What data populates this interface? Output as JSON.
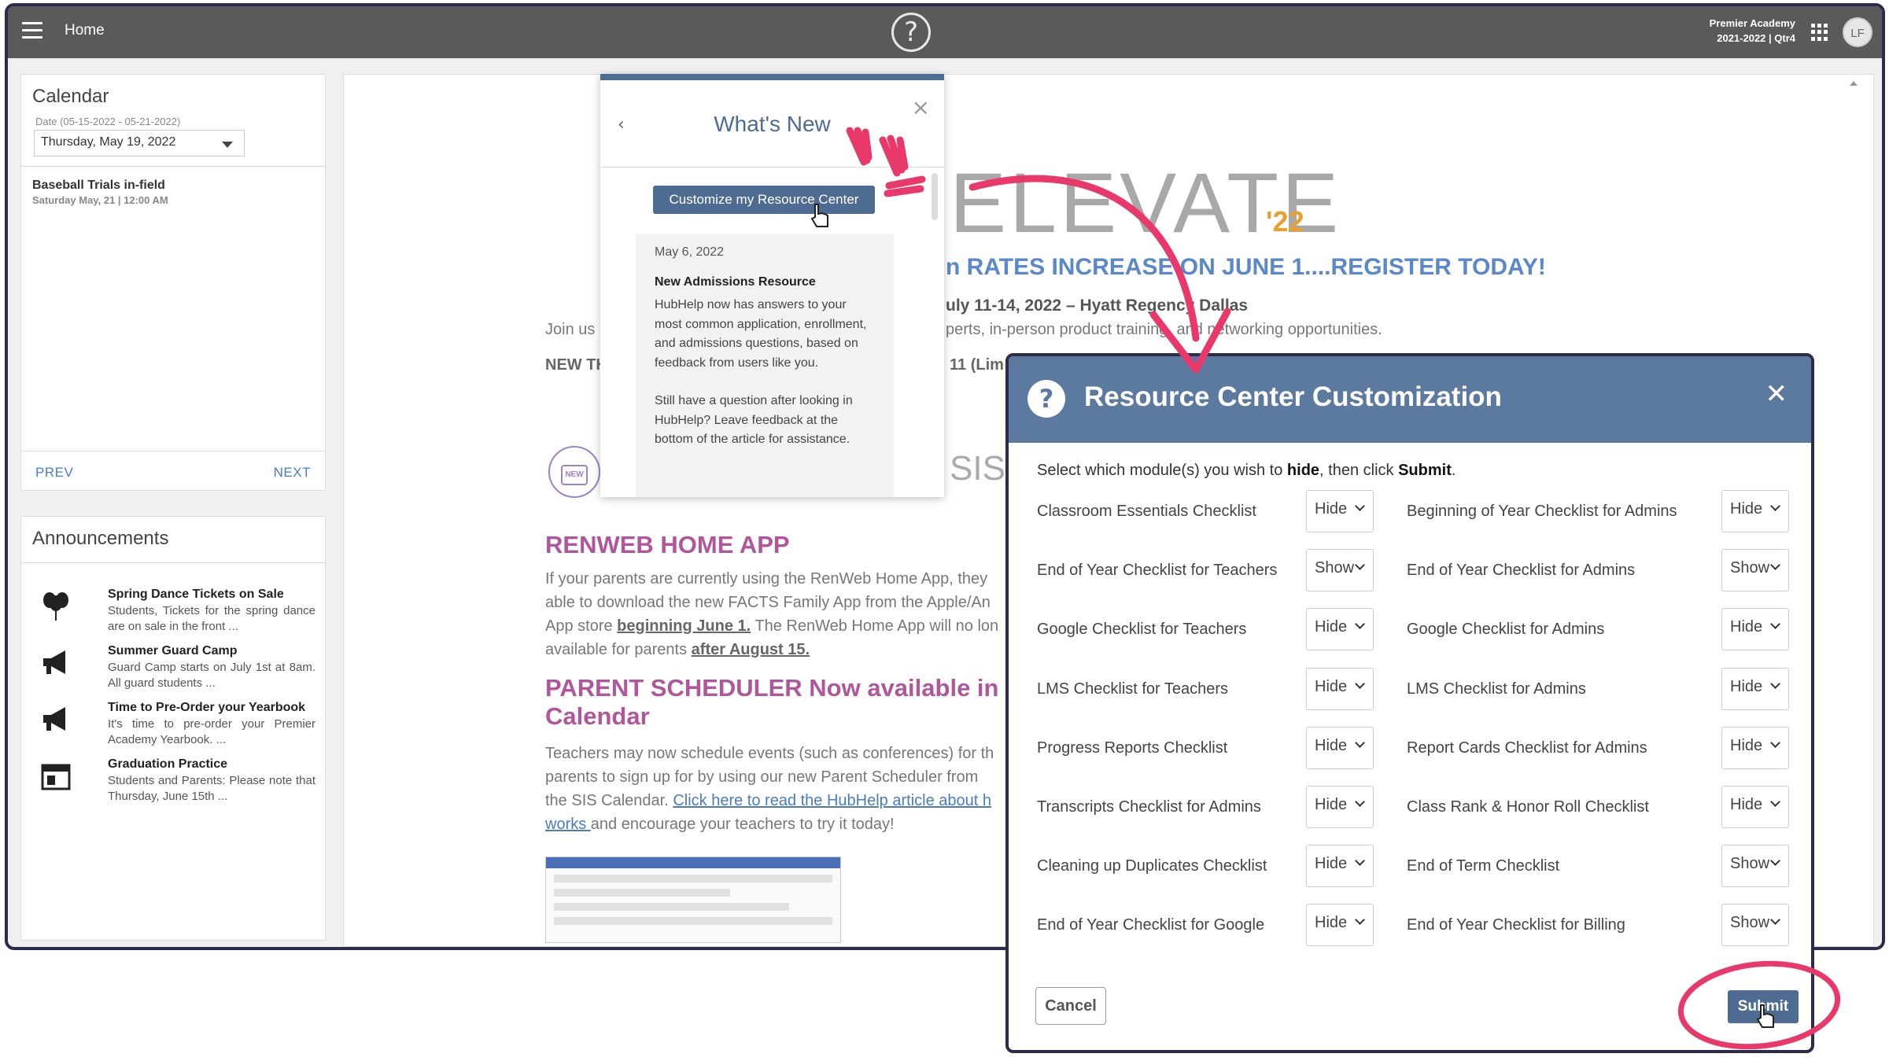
{
  "topbar": {
    "home_label": "Home",
    "school_name": "Premier Academy",
    "school_term": "2021-2022 | Qtr4",
    "avatar_initials": "LF"
  },
  "calendar": {
    "title": "Calendar",
    "date_range_label": "Date (05-15-2022 - 05-21-2022)",
    "selected_date": "Thursday, May 19, 2022",
    "event_title": "Baseball Trials in-field",
    "event_time": "Saturday May, 21 | 12:00 AM",
    "prev_label": "PREV",
    "next_label": "NEXT"
  },
  "announcements": {
    "title": "Announcements",
    "items": [
      {
        "icon": "balloons-icon",
        "title": "Spring Dance Tickets on Sale",
        "text": "Students, Tickets for the spring dance are on sale in the front ..."
      },
      {
        "icon": "megaphone-icon",
        "title": "Summer Guard Camp",
        "text": "Guard Camp starts on July 1st at 8am. All guard students ..."
      },
      {
        "icon": "megaphone-icon",
        "title": "Time to Pre-Order your Yearbook",
        "text": "It's time to pre-order your Premier Academy Yearbook. ..."
      },
      {
        "icon": "calendar-icon",
        "title": "Graduation Practice",
        "text": "Students and Parents: Please note that Thursday, June 15th ..."
      }
    ]
  },
  "main": {
    "logo_text": "ELEVATE",
    "logo_year": "'22",
    "rates_line": "n RATES INCREASE ON JUNE 1....REGISTER TODAY!",
    "dates_line": "uly 11-14, 2022 – Hyatt Regency Dallas",
    "join_text": "Join us i",
    "join_right": "perts, in-person product training, and networking opportunities.",
    "new_th": "NEW TH",
    "limit_text": "11 (Lim",
    "new_badge": "NEW",
    "sis_text": "SIS",
    "renweb_head": "RENWEB HOME APP",
    "renweb_l1": "If your parents are currently using the RenWeb Home App, they",
    "renweb_l2": "able to download the new FACTS Family App from the Apple/An",
    "renweb_l3a": "App store ",
    "renweb_l3b": "beginning June 1.",
    "renweb_l3c": " The RenWeb Home App will no lon",
    "renweb_l4a": "available for parents ",
    "renweb_l4b": "after August 15.",
    "scheduler_head_1": "PARENT SCHEDULER Now available in",
    "scheduler_head_2": "Calendar",
    "sched_l1": "Teachers may now schedule events (such as conferences) for th",
    "sched_l2": "parents to sign up for by using our new Parent Scheduler from",
    "sched_l3a": "the SIS Calendar. ",
    "sched_l3b": "Click here to read the HubHelp article about h",
    "sched_l4a": "works ",
    "sched_l4b": "and encourage your teachers to try it today!"
  },
  "whats_new": {
    "title": "What's New",
    "customize_button": "Customize my Resource Center",
    "date": "May 6, 2022",
    "heading": "New Admissions Resource",
    "body": "HubHelp now has answers to your most common application, enrollment, and admissions questions, based on feedback from users like you.",
    "body2": "Still have a question after looking in HubHelp? Leave feedback at the bottom of the article for assistance."
  },
  "resource_center": {
    "title": "Resource Center Customization",
    "instruction_pre": "Select which module(s) you wish to ",
    "instruction_hide": "hide",
    "instruction_mid": ", then click ",
    "instruction_submit": "Submit",
    "instruction_end": ".",
    "left": [
      {
        "label": "Classroom Essentials Checklist",
        "value": "Hide"
      },
      {
        "label": "End of Year Checklist for Teachers",
        "value": "Show"
      },
      {
        "label": "Google Checklist for Teachers",
        "value": "Hide"
      },
      {
        "label": "LMS Checklist for Teachers",
        "value": "Hide"
      },
      {
        "label": "Progress Reports Checklist",
        "value": "Hide"
      },
      {
        "label": "Transcripts Checklist for Admins",
        "value": "Hide"
      },
      {
        "label": "Cleaning up Duplicates Checklist",
        "value": "Hide"
      },
      {
        "label": "End of Year Checklist for Google",
        "value": "Hide"
      }
    ],
    "right": [
      {
        "label": "Beginning of Year Checklist for Admins",
        "value": "Hide"
      },
      {
        "label": "End of Year Checklist for Admins",
        "value": "Show"
      },
      {
        "label": "Google Checklist for Admins",
        "value": "Hide"
      },
      {
        "label": "LMS Checklist for Admins",
        "value": "Hide"
      },
      {
        "label": "Report Cards Checklist for Admins",
        "value": "Hide"
      },
      {
        "label": "Class Rank & Honor Roll Checklist",
        "value": "Hide"
      },
      {
        "label": "End of Term Checklist",
        "value": "Show"
      },
      {
        "label": "End of Year Checklist for Billing",
        "value": "Show"
      }
    ],
    "cancel_label": "Cancel",
    "submit_label": "Submit"
  },
  "colors": {
    "topbar": "#5a5a5a",
    "accent_blue": "#4e6c91",
    "heading_purple": "#b0569a",
    "annotation_pink": "#e8396a"
  }
}
